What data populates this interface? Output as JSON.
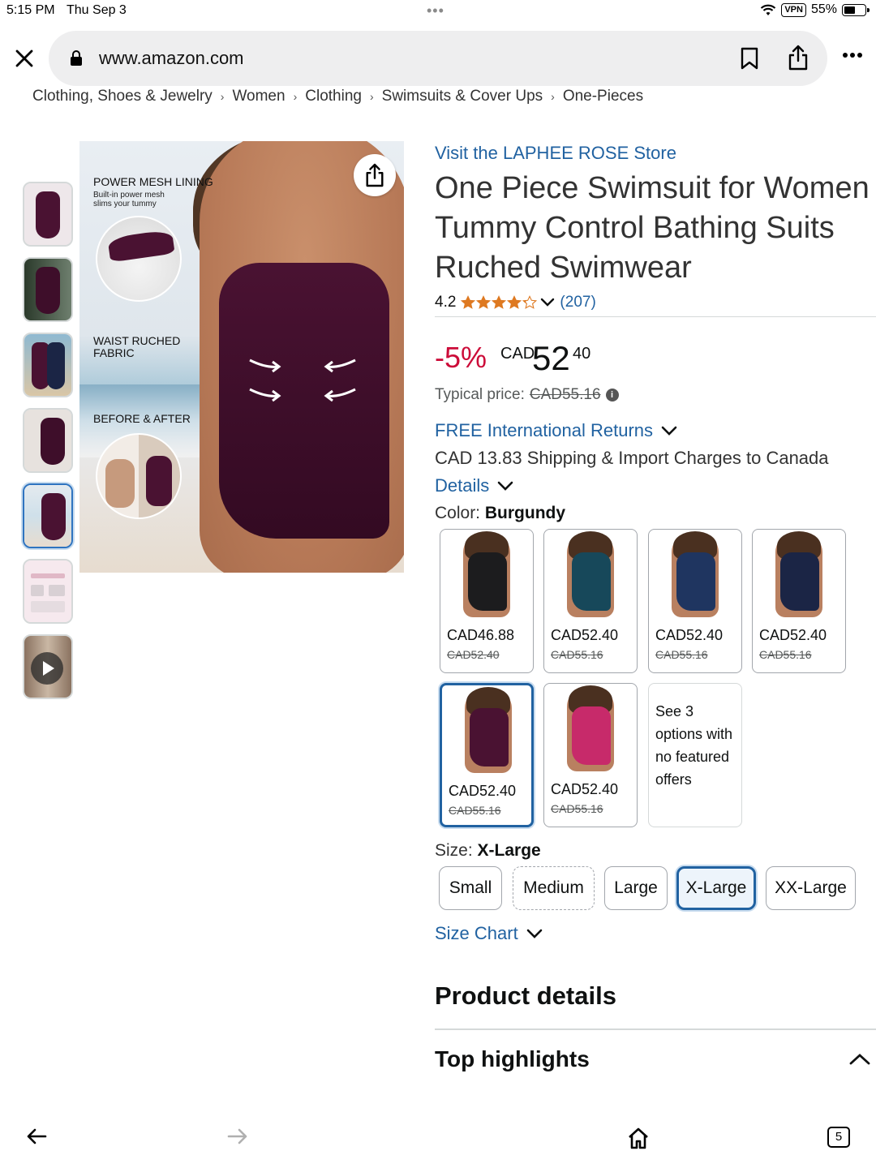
{
  "status_bar": {
    "time": "5:15 PM",
    "date": "Thu Sep 3",
    "vpn": "VPN",
    "battery_percent": "55%",
    "battery_level": 0.55
  },
  "browser": {
    "url": "www.amazon.com",
    "icons": [
      "close-icon",
      "lock-icon",
      "bookmark-icon",
      "share-icon",
      "more-icon"
    ]
  },
  "breadcrumb": [
    "Clothing, Shoes & Jewelry",
    "Women",
    "Clothing",
    "Swimsuits & Cover Ups",
    "One-Pieces"
  ],
  "image_gallery": {
    "thumbnail_count": 7,
    "selected_index": 4,
    "main_image_labels": {
      "label1": "POWER MESH LINING",
      "label1_sub1": "Built-in power mesh",
      "label1_sub2": "slims your tummy",
      "label2_line1": "WAIST RUCHED",
      "label2_line2": "FABRIC",
      "label3": "BEFORE & AFTER"
    }
  },
  "product": {
    "store_link": "Visit the LAPHEE ROSE Store",
    "title": "One Piece Swimsuit for Women Tummy Control Bathing Suits Ruched Swimwear",
    "rating": "4.2",
    "rating_value": 4.2,
    "review_count": "(207)",
    "discount": "-5%",
    "currency": "CAD",
    "price_whole": "52",
    "price_fraction": "40",
    "typical_label": "Typical price:",
    "typical_price": "CAD55.16",
    "returns": "FREE International Returns",
    "shipping": "CAD 13.83 Shipping & Import Charges to Canada",
    "details_link": "Details",
    "color_label": "Color:",
    "color_value": "Burgundy",
    "size_label": "Size:",
    "size_value": "X-Large",
    "size_chart": "Size Chart"
  },
  "colors": [
    {
      "price": "CAD46.88",
      "old": "CAD52.40",
      "suit_color": "#1c1c1e"
    },
    {
      "price": "CAD52.40",
      "old": "CAD55.16",
      "suit_color": "#17485a"
    },
    {
      "price": "CAD52.40",
      "old": "CAD55.16",
      "suit_color": "#1f3560"
    },
    {
      "price": "CAD52.40",
      "old": "CAD55.16",
      "suit_color": "#1b2545"
    },
    {
      "price": "CAD52.40",
      "old": "CAD55.16",
      "suit_color": "#4a1232",
      "selected": true
    },
    {
      "price": "CAD52.40",
      "old": "CAD55.16",
      "suit_color": "#c72a6a"
    }
  ],
  "more_options": "See 3 options with no featured offers",
  "sizes": [
    {
      "label": "Small"
    },
    {
      "label": "Medium",
      "unavailable": true
    },
    {
      "label": "Large"
    },
    {
      "label": "X-Large",
      "selected": true
    },
    {
      "label": "XX-Large"
    }
  ],
  "sections": {
    "product_details": "Product details",
    "top_highlights": "Top highlights"
  },
  "toolbar": {
    "tab_count": "5"
  },
  "colors_theme": {
    "link": "#2162a1",
    "deal_red": "#cc0c39",
    "star": "#de7921",
    "selected_border": "#2162a1"
  }
}
